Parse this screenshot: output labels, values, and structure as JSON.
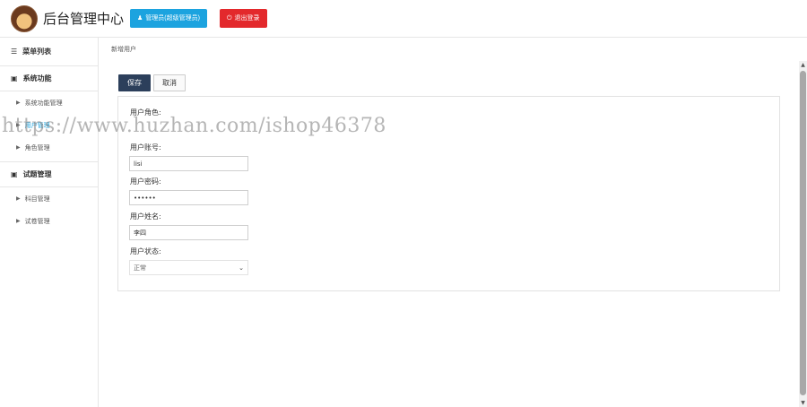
{
  "header": {
    "title": "后台管理中心",
    "admin_button": "管理员(超级管理员)",
    "logout_button": "退出登录"
  },
  "sidebar": {
    "heading": "菜单列表",
    "groups": [
      {
        "label": "系统功能",
        "items": [
          "系统功能管理",
          "用户管理",
          "角色管理"
        ]
      },
      {
        "label": "试题管理",
        "items": [
          "科目管理",
          "试卷管理"
        ]
      }
    ]
  },
  "breadcrumb": "新增用户",
  "toolbar": {
    "save": "保存",
    "cancel": "取消"
  },
  "form": {
    "role_label": "用户角色:",
    "account_label": "用户账号:",
    "account_value": "lisi",
    "password_label": "用户密码:",
    "password_value": "••••••",
    "name_label": "用户姓名:",
    "name_value": "李四",
    "status_label": "用户状态:",
    "status_value": "正常"
  },
  "watermark": "https://www.huzhan.com/ishop46378",
  "colors": {
    "accent_blue": "#1ca3df",
    "logout_red": "#e3292c",
    "save_navy": "#2c3f5b"
  }
}
